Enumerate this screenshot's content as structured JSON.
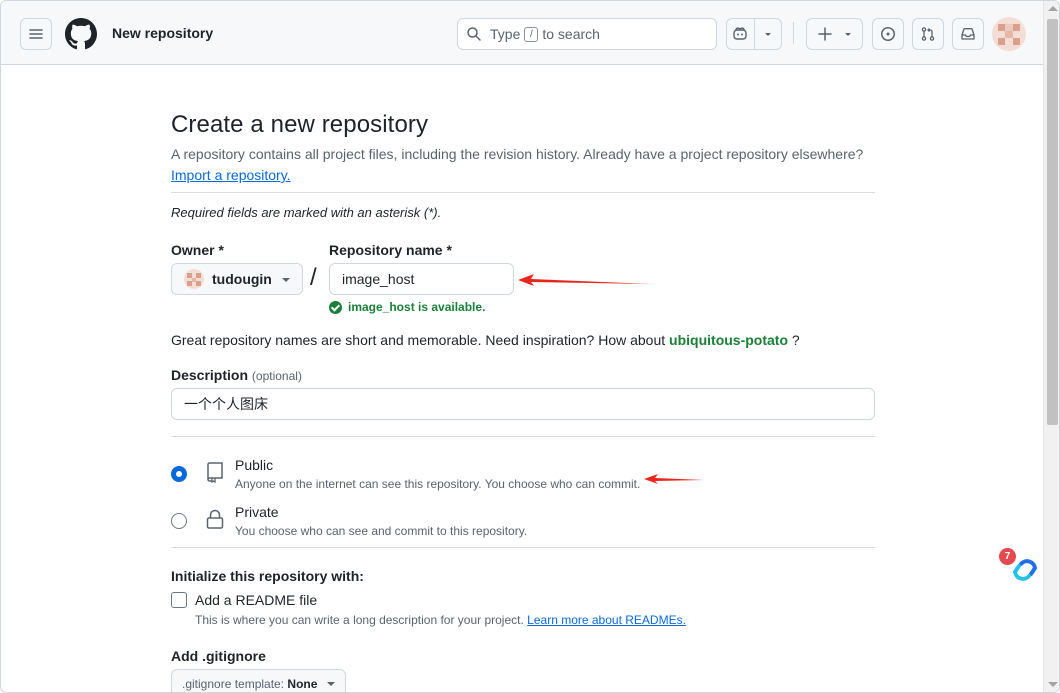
{
  "header": {
    "context_title": "New repository",
    "search": {
      "placeholder_prefix": "Type",
      "slash_key": "/",
      "placeholder_suffix": "to search"
    },
    "icons": [
      "hamburger-icon",
      "github-logo-icon",
      "search-icon",
      "copilot-icon",
      "plus-icon",
      "issues-icon",
      "pull-request-icon",
      "inbox-icon"
    ]
  },
  "page": {
    "title": "Create a new repository",
    "subtitle": "A repository contains all project files, including the revision history. Already have a project repository elsewhere?",
    "import_link": "Import a repository.",
    "required_note": "Required fields are marked with an asterisk (*)."
  },
  "form": {
    "owner_label": "Owner *",
    "owner_value": "tudougin",
    "separator": "/",
    "repo_label": "Repository name *",
    "repo_value": "image_host",
    "availability": "image_host is available.",
    "hint_prefix": "Great repository names are short and memorable. Need inspiration? How about",
    "hint_suggestion": "ubiquitous-potato",
    "hint_suffix": "?",
    "description_label": "Description",
    "description_optional": "(optional)",
    "description_value": "一个个人图床",
    "visibility": [
      {
        "title": "Public",
        "desc": "Anyone on the internet can see this repository. You choose who can commit.",
        "selected": true,
        "icon": "repo-icon"
      },
      {
        "title": "Private",
        "desc": "You choose who can see and commit to this repository.",
        "selected": false,
        "icon": "lock-icon"
      }
    ],
    "init_title": "Initialize this repository with:",
    "readme_label": "Add a README file",
    "readme_desc": "This is where you can write a long description for your project.",
    "readme_link": "Learn more about READMEs.",
    "readme_checked": false,
    "gitignore_title": "Add .gitignore",
    "gitignore_prefix": ".gitignore template:",
    "gitignore_value": "None"
  },
  "widget": {
    "badge_count": "7"
  },
  "colors": {
    "accent": "#0969da",
    "success": "#1a7f37",
    "annotation_arrow": "#e8261c"
  }
}
